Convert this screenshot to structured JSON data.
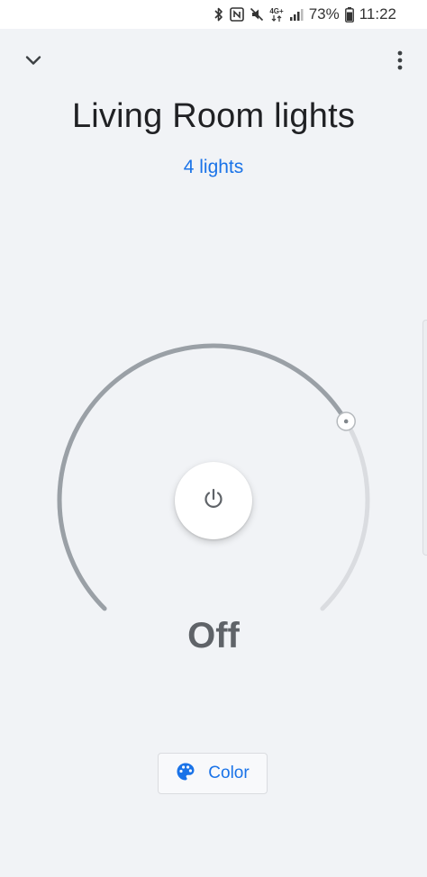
{
  "status_bar": {
    "battery_percent": "73%",
    "time": "11:22",
    "network_label": "4G+",
    "icons": [
      "bluetooth-icon",
      "nfc-icon",
      "mute-icon",
      "network-4g-icon",
      "signal-icon",
      "battery-icon"
    ]
  },
  "header": {
    "title": "Living Room lights",
    "subtitle": "4 lights",
    "back_icon": "chevron-down-icon",
    "menu_icon": "more-vert-icon"
  },
  "control": {
    "state": "Off",
    "power_icon": "power-icon",
    "brightness_level": 0.72
  },
  "actions": {
    "color_label": "Color",
    "color_icon": "palette-icon"
  },
  "colors": {
    "accent": "#1a73e8",
    "background": "#f1f3f6",
    "dial_active": "#9aa0a6",
    "dial_inactive": "#dadce0"
  }
}
